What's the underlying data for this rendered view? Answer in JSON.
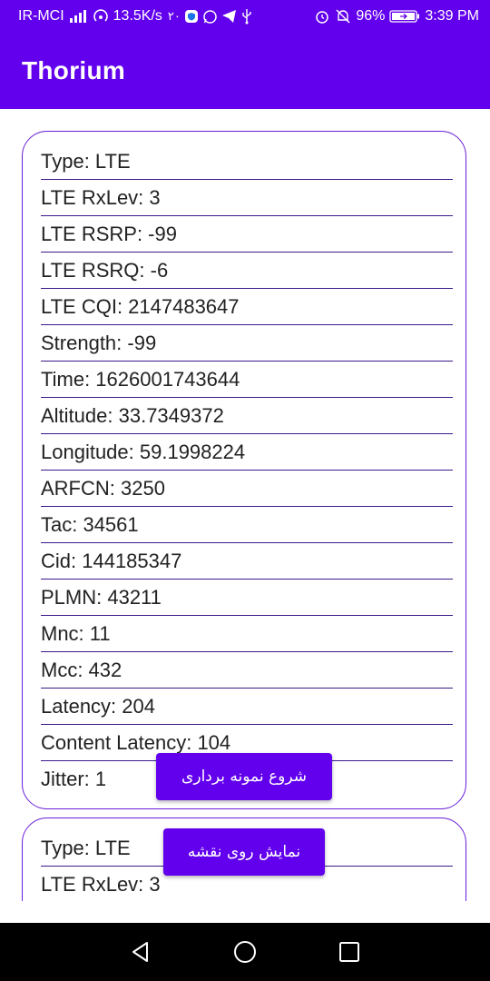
{
  "status_bar": {
    "carrier": "IR-MCI",
    "speed": "13.5K/s",
    "notif_number": "۲۰",
    "battery": "96%",
    "time": "3:39 PM"
  },
  "app_bar": {
    "title": "Thorium"
  },
  "cards": [
    {
      "rows": [
        "Type: LTE",
        "LTE RxLev: 3",
        "LTE RSRP: -99",
        "LTE RSRQ: -6",
        "LTE CQI: 2147483647",
        "Strength: -99",
        "Time: 1626001743644",
        "Altitude: 33.7349372",
        "Longitude: 59.1998224",
        "ARFCN: 3250",
        "Tac: 34561",
        "Cid: 144185347",
        "PLMN: 43211",
        "Mnc: 11",
        "Mcc: 432",
        "Latency: 204",
        "Content Latency: 104",
        "Jitter: 1"
      ]
    },
    {
      "rows": [
        "Type: LTE",
        "LTE RxLev: 3"
      ]
    }
  ],
  "buttons": {
    "start_sampling": "شروع نمونه برداری",
    "show_on_map": "نمایش روی نقشه"
  },
  "colors": {
    "primary": "#6200EE",
    "card_border": "#6a1fd6",
    "divider": "#3a1a8a"
  }
}
